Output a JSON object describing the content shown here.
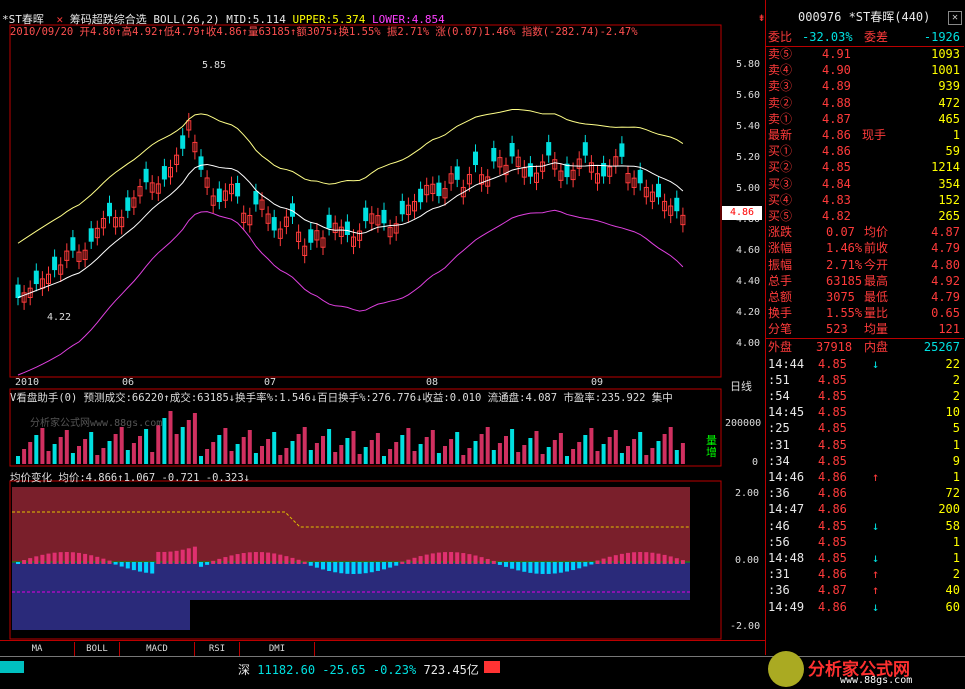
{
  "header": {
    "stock_name": "*ST春晖",
    "indicator": "筹码超跌综合选",
    "boll_params": "BOLL(26,2)",
    "mid_label": "MID:5.114",
    "upper_label": "UPPER:5.374",
    "lower_label": "LOWER:4.854",
    "info_line": "2010/09/20 开4.80↑高4.92↑低4.79↑收4.86↑量63185↑额3075↓换1.55% 振2.71% 涨(0.07)1.46% 指数(-282.74)-2.47%"
  },
  "price_axis": {
    "ticks": [
      "5.80",
      "5.60",
      "5.40",
      "5.20",
      "5.00",
      "4.80",
      "4.60",
      "4.40",
      "4.20",
      "4.00"
    ],
    "current": "4.86"
  },
  "annotations": {
    "high": "5.85",
    "low": "4.22"
  },
  "months": [
    "2010",
    "06",
    "07",
    "08",
    "09"
  ],
  "period": "日线",
  "vol_panel": {
    "title": "V看盘助手(0) 预测成交:66220↑成交:63185↓换手率%:1.546↓百日换手%:276.776↓收益:0.010 流通盘:4.087 市盈率:235.922 集中",
    "watermark": "分析家公式网www.88gs.com",
    "axis": [
      "200000",
      "0"
    ],
    "side_label": "量增"
  },
  "osc_panel": {
    "title": "均价变化 均价:4.866↑1.067 -0.721 -0.323↓",
    "axis": [
      "2.00",
      "0.00",
      "-2.00"
    ]
  },
  "tabs": [
    "MA",
    "BOLL",
    "MACD",
    "RSI",
    "DMI"
  ],
  "status": {
    "index_name": "深",
    "value": "11182.60",
    "change": "-25.65",
    "pct": "-0.23%",
    "amount": "723.45亿",
    "logo": "分析家公式网",
    "logo_url": "www.88gs.com"
  },
  "quote": {
    "code_line": "000976 *ST春晖(440)",
    "weibi_label": "委比",
    "weibi": "-32.03%",
    "weicha_label": "委差",
    "weicha": "-1926",
    "asks": [
      {
        "label": "卖⑤",
        "price": "4.91",
        "vol": "1093"
      },
      {
        "label": "卖④",
        "price": "4.90",
        "vol": "1001"
      },
      {
        "label": "卖③",
        "price": "4.89",
        "vol": "939"
      },
      {
        "label": "卖②",
        "price": "4.88",
        "vol": "472"
      },
      {
        "label": "卖①",
        "price": "4.87",
        "vol": "465"
      }
    ],
    "last_label": "最新",
    "last": "4.86",
    "now_label": "现手",
    "now": "1",
    "bids": [
      {
        "label": "买①",
        "price": "4.86",
        "vol": "59"
      },
      {
        "label": "买②",
        "price": "4.85",
        "vol": "1214"
      },
      {
        "label": "买③",
        "price": "4.84",
        "vol": "354"
      },
      {
        "label": "买④",
        "price": "4.83",
        "vol": "152"
      },
      {
        "label": "买⑤",
        "price": "4.82",
        "vol": "265"
      }
    ],
    "stats": [
      {
        "l1": "涨跌",
        "v1": "0.07",
        "l2": "均价",
        "v2": "4.87"
      },
      {
        "l1": "涨幅",
        "v1": "1.46%",
        "l2": "前收",
        "v2": "4.79"
      },
      {
        "l1": "振幅",
        "v1": "2.71%",
        "l2": "今开",
        "v2": "4.80"
      },
      {
        "l1": "总手",
        "v1": "63185",
        "l2": "最高",
        "v2": "4.92"
      },
      {
        "l1": "总额",
        "v1": "3075",
        "l2": "最低",
        "v2": "4.79"
      },
      {
        "l1": "换手",
        "v1": "1.55%",
        "l2": "量比",
        "v2": "0.65"
      },
      {
        "l1": "分笔",
        "v1": "523",
        "l2": "均量",
        "v2": "121"
      }
    ],
    "outer_label": "外盘",
    "outer": "37918",
    "inner_label": "内盘",
    "inner": "25267",
    "ticks": [
      {
        "t": "14:44",
        "p": "4.85",
        "d": "↓",
        "v": "22"
      },
      {
        "t": ":51",
        "p": "4.85",
        "d": "",
        "v": "2"
      },
      {
        "t": ":54",
        "p": "4.85",
        "d": "",
        "v": "2"
      },
      {
        "t": "14:45",
        "p": "4.85",
        "d": "",
        "v": "10"
      },
      {
        "t": ":25",
        "p": "4.85",
        "d": "",
        "v": "5"
      },
      {
        "t": ":31",
        "p": "4.85",
        "d": "",
        "v": "1"
      },
      {
        "t": ":34",
        "p": "4.85",
        "d": "",
        "v": "9"
      },
      {
        "t": "14:46",
        "p": "4.86",
        "d": "↑",
        "v": "1"
      },
      {
        "t": ":36",
        "p": "4.86",
        "d": "",
        "v": "72"
      },
      {
        "t": "14:47",
        "p": "4.86",
        "d": "",
        "v": "200"
      },
      {
        "t": ":46",
        "p": "4.85",
        "d": "↓",
        "v": "58"
      },
      {
        "t": ":56",
        "p": "4.85",
        "d": "",
        "v": "1"
      },
      {
        "t": "14:48",
        "p": "4.85",
        "d": "↓",
        "v": "1"
      },
      {
        "t": ":31",
        "p": "4.86",
        "d": "↑",
        "v": "2"
      },
      {
        "t": ":36",
        "p": "4.87",
        "d": "↑",
        "v": "40"
      },
      {
        "t": "14:49",
        "p": "4.86",
        "d": "↓",
        "v": "60"
      }
    ]
  },
  "colors": {
    "up": "#ff3b3b",
    "down": "#00e0e0",
    "upper": "#ffff88",
    "mid": "#ffffff",
    "lower": "#e040e0",
    "maroon": "#7a1f2b",
    "navy": "#2a2a7a"
  }
}
